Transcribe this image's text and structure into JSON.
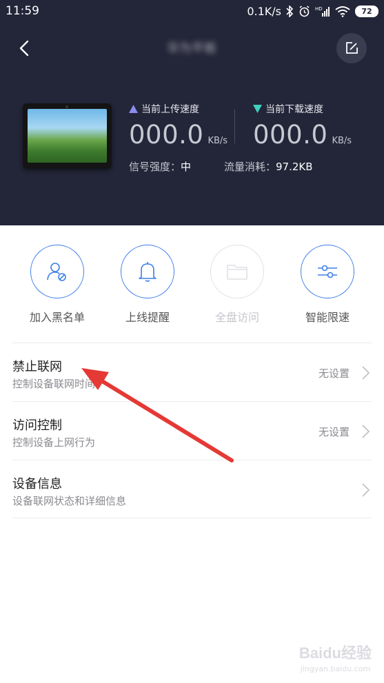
{
  "status_bar": {
    "time": "11:59",
    "net_speed": "0.1K/s",
    "battery": "72"
  },
  "header": {
    "title": "华为平板",
    "upload": {
      "label": "当前上传速度",
      "value": "000.0",
      "unit": "KB/s",
      "color": "#8a8cf0"
    },
    "download": {
      "label": "当前下载速度",
      "value": "000.0",
      "unit": "KB/s",
      "color": "#3fd0c0"
    },
    "signal": {
      "label": "信号强度：",
      "value": "中"
    },
    "traffic": {
      "label": "流量消耗：",
      "value": "97.2KB"
    }
  },
  "actions": [
    {
      "label": "加入黑名单",
      "icon": "user-block-icon",
      "enabled": true
    },
    {
      "label": "上线提醒",
      "icon": "bell-icon",
      "enabled": true
    },
    {
      "label": "全盘访问",
      "icon": "folder-icon",
      "enabled": false
    },
    {
      "label": "智能限速",
      "icon": "sliders-icon",
      "enabled": true
    }
  ],
  "settings": [
    {
      "title": "禁止联网",
      "subtitle": "控制设备联网时间",
      "value": "无设置"
    },
    {
      "title": "访问控制",
      "subtitle": "控制设备上网行为",
      "value": "无设置"
    },
    {
      "title": "设备信息",
      "subtitle": "设备联网状态和详细信息",
      "value": ""
    }
  ],
  "watermark": {
    "brand": "Baidu经验",
    "url": "jingyan.baidu.com"
  },
  "colors": {
    "header_bg": "#232538",
    "accent_blue": "#3d7ee8",
    "annotation_red": "#e53935"
  }
}
